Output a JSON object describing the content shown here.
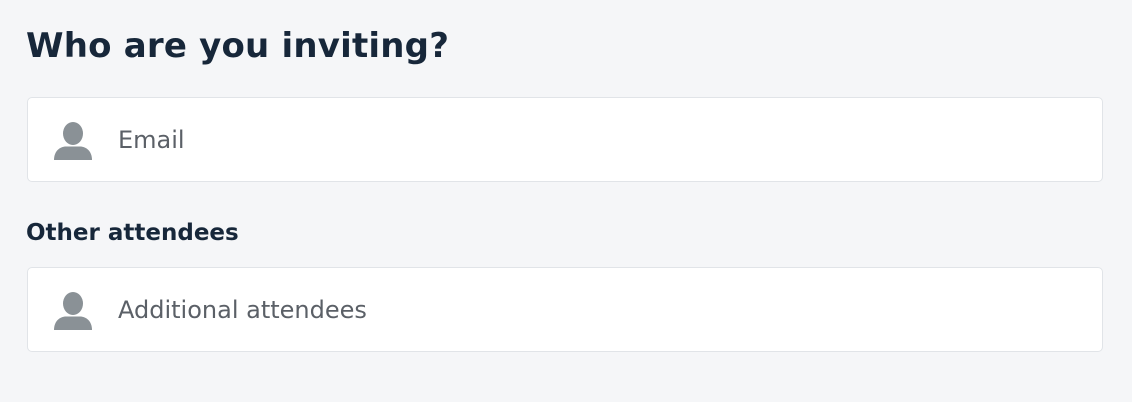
{
  "heading": {
    "title": "Who are you inviting?"
  },
  "email_field": {
    "placeholder": "Email",
    "value": "",
    "icon": "person-icon"
  },
  "other_attendees": {
    "label": "Other attendees",
    "placeholder": "Additional attendees",
    "value": "",
    "icon": "person-icon"
  },
  "colors": {
    "background": "#f5f6f8",
    "heading_text": "#17273a",
    "field_background": "#ffffff",
    "field_border": "#e1e4e8",
    "icon": "#8a9196",
    "placeholder_text": "#5b6067"
  }
}
